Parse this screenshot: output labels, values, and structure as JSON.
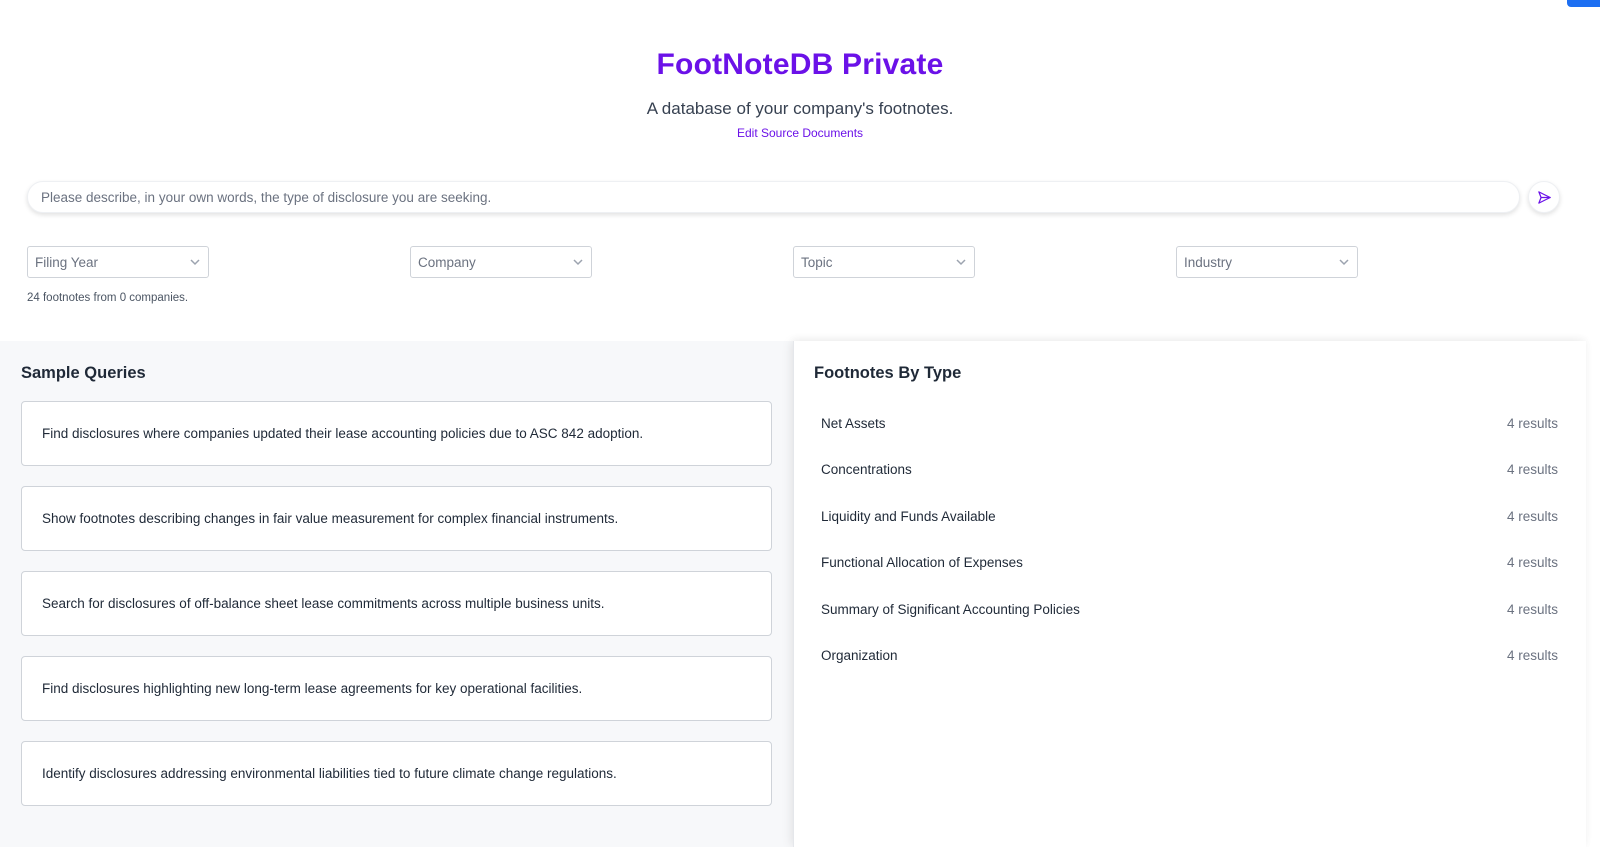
{
  "header": {
    "title": "FootNoteDB Private",
    "subtitle": "A database of your company's footnotes.",
    "edit_link": "Edit Source Documents"
  },
  "search": {
    "placeholder": "Please describe, in your own words, the type of disclosure you are seeking.",
    "value": ""
  },
  "filters": [
    {
      "label": "Filing Year"
    },
    {
      "label": "Company"
    },
    {
      "label": "Topic"
    },
    {
      "label": "Industry"
    }
  ],
  "summary": "24 footnotes from 0 companies.",
  "sample_queries": {
    "title": "Sample Queries",
    "items": [
      "Find disclosures where companies updated their lease accounting policies due to ASC 842 adoption.",
      "Show footnotes describing changes in fair value measurement for complex financial instruments.",
      "Search for disclosures of off-balance sheet lease commitments across multiple business units.",
      "Find disclosures highlighting new long-term lease agreements for key operational facilities.",
      "Identify disclosures addressing environmental liabilities tied to future climate change regulations."
    ]
  },
  "footnotes_by_type": {
    "title": "Footnotes By Type",
    "items": [
      {
        "name": "Net Assets",
        "count": "4 results"
      },
      {
        "name": "Concentrations",
        "count": "4 results"
      },
      {
        "name": "Liquidity and Funds Available",
        "count": "4 results"
      },
      {
        "name": "Functional Allocation of Expenses",
        "count": "4 results"
      },
      {
        "name": "Summary of Significant Accounting Policies",
        "count": "4 results"
      },
      {
        "name": "Organization",
        "count": "4 results"
      }
    ]
  },
  "colors": {
    "brand": "#6b11e8",
    "corner_button": "#1d6ff2"
  },
  "icons": {
    "send": "send-icon",
    "dropdown": "chevron-down-icon"
  }
}
